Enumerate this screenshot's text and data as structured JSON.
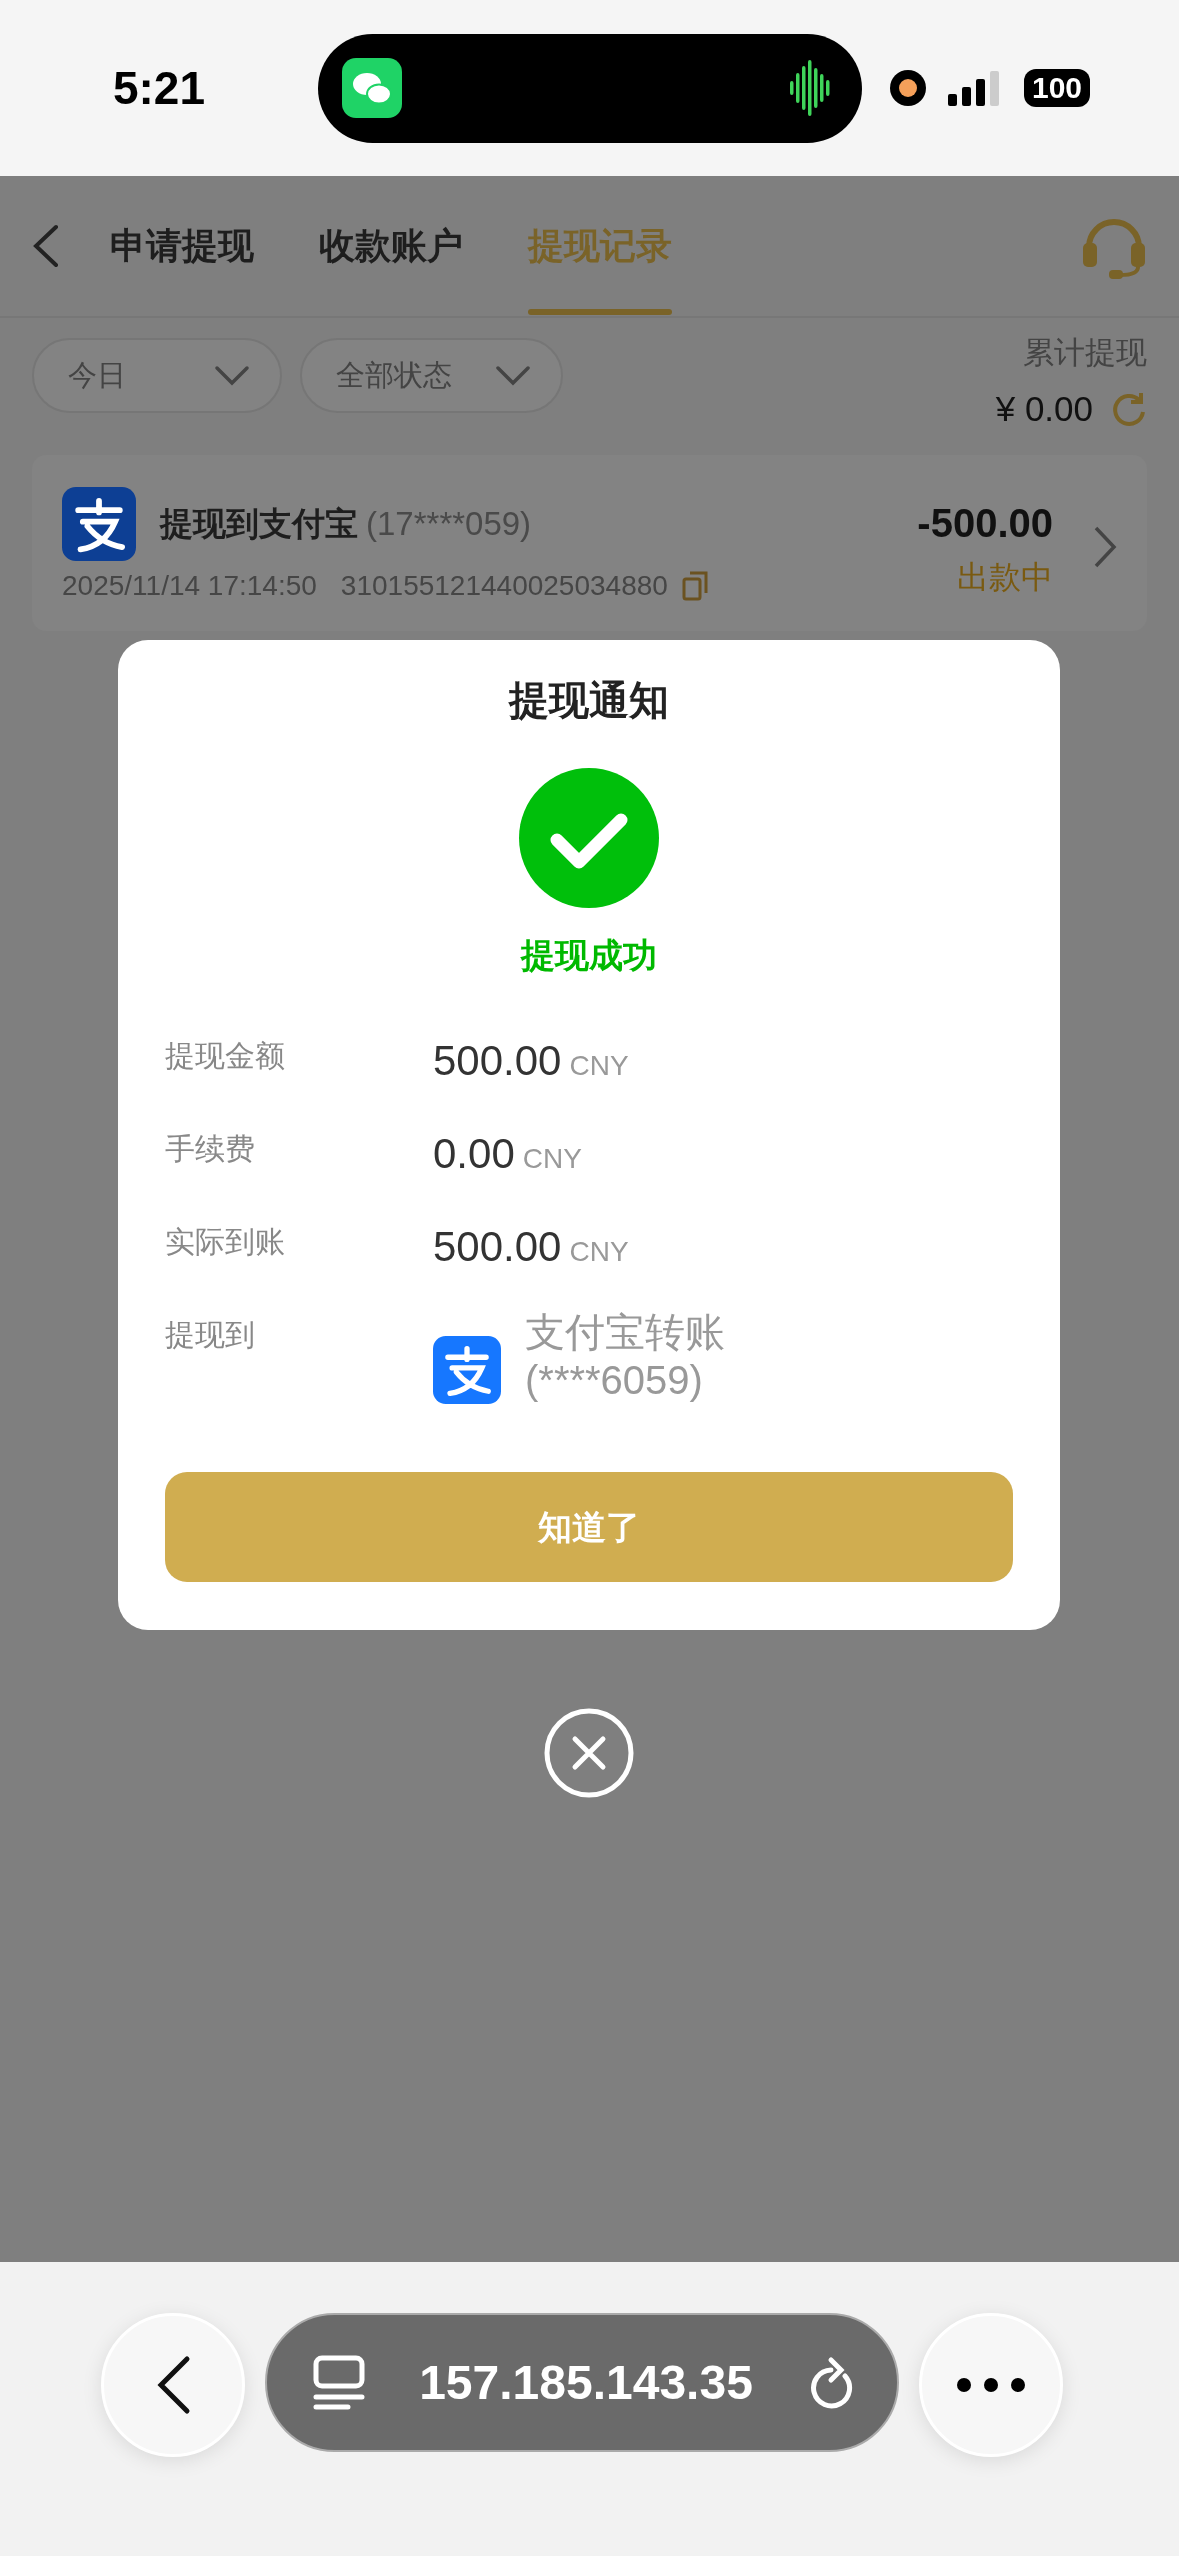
{
  "status_bar": {
    "time": "5:21",
    "battery": "100"
  },
  "nav": {
    "tabs": [
      {
        "label": "申请提现",
        "selected": false
      },
      {
        "label": "收款账户",
        "selected": false
      },
      {
        "label": "提现记录",
        "selected": true
      }
    ]
  },
  "filters": [
    {
      "label": "今日"
    },
    {
      "label": "全部状态"
    }
  ],
  "total": {
    "label": "累计提现",
    "amount": "¥ 0.00"
  },
  "records": [
    {
      "title": "提现到支付宝",
      "account": "(17****059)",
      "time": "2025/11/14 17:14:50",
      "order_no": "310155121440025034880",
      "amount": "-500.00",
      "status": "出款中"
    }
  ],
  "dialog": {
    "title": "提现通知",
    "result": "提现成功",
    "rows": [
      {
        "kind": "amount",
        "label": "提现金额",
        "value": "500.00",
        "unit": "CNY"
      },
      {
        "kind": "amount",
        "label": "手续费",
        "value": "0.00",
        "unit": "CNY"
      },
      {
        "kind": "amount",
        "label": "实际到账",
        "value": "500.00",
        "unit": "CNY"
      },
      {
        "kind": "account",
        "label": "提现到",
        "value": "支付宝转账",
        "account": "(****6059)"
      }
    ],
    "button": "知道了"
  },
  "browser": {
    "url": "157.185.143.35"
  }
}
